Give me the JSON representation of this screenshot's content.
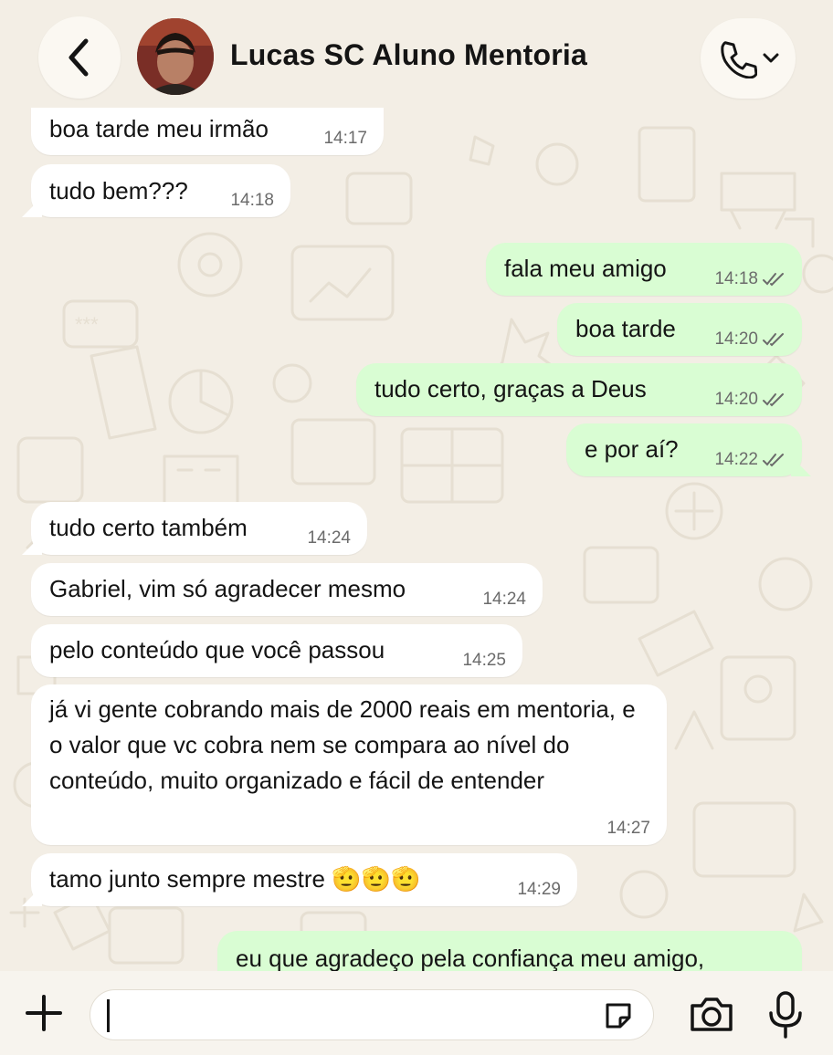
{
  "header": {
    "contact_name": "Lucas SC Aluno Mentoria"
  },
  "messages": [
    {
      "dir": "in",
      "text": "boa tarde meu irmão",
      "time": "14:17"
    },
    {
      "dir": "in",
      "text": "tudo bem???",
      "time": "14:18"
    },
    {
      "dir": "out",
      "text": "fala meu amigo",
      "time": "14:18",
      "status": "read"
    },
    {
      "dir": "out",
      "text": "boa tarde",
      "time": "14:20",
      "status": "read"
    },
    {
      "dir": "out",
      "text": "tudo certo, graças a Deus",
      "time": "14:20",
      "status": "read"
    },
    {
      "dir": "out",
      "text": "e por aí?",
      "time": "14:22",
      "status": "read"
    },
    {
      "dir": "in",
      "text": "tudo certo também",
      "time": "14:24"
    },
    {
      "dir": "in",
      "text": "Gabriel, vim só agradecer mesmo",
      "time": "14:24"
    },
    {
      "dir": "in",
      "text": "pelo conteúdo que você passou",
      "time": "14:25"
    },
    {
      "dir": "in",
      "text": "já vi gente cobrando mais de 2000 reais em mentoria, e o valor que vc cobra nem se compara ao nível do conteúdo, muito organizado e fácil de entender",
      "time": "14:27"
    },
    {
      "dir": "in",
      "text": "tamo junto sempre mestre 🫡🫡🫡",
      "time": "14:29"
    },
    {
      "dir": "out",
      "text": "eu que agradeço pela confiança meu amigo,",
      "time": "",
      "status": ""
    }
  ],
  "composer": {
    "value": "",
    "placeholder": ""
  },
  "icons": {
    "back": "chevron-left-icon",
    "call": "phone-icon",
    "call_menu": "chevron-down-icon",
    "attach": "plus-icon",
    "sticker": "sticker-icon",
    "camera": "camera-icon",
    "mic": "microphone-icon"
  },
  "colors": {
    "background": "#f3eee5",
    "incoming_bubble": "#ffffff",
    "outgoing_bubble": "#d9fdd3",
    "timestamp": "#6b6b6b"
  }
}
